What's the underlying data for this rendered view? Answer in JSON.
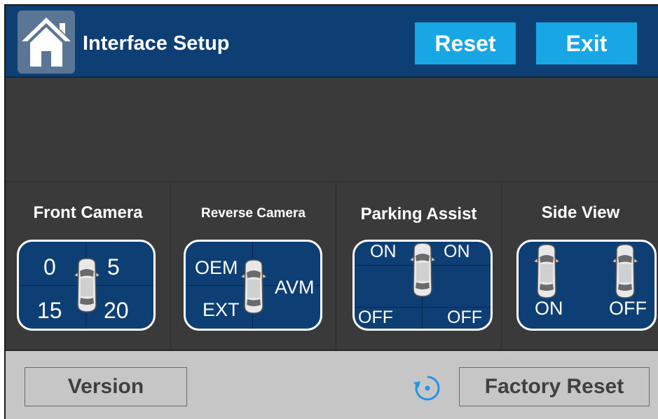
{
  "header": {
    "home_icon": "home-icon",
    "title": "Interface Setup",
    "reset_label": "Reset",
    "exit_label": "Exit"
  },
  "front_camera": {
    "label": "Front Camera",
    "top_left": "0",
    "top_right": "5",
    "bottom_left": "15",
    "bottom_right": "20",
    "icon": "car-top-view-icon"
  },
  "reverse_camera": {
    "label": "Reverse Camera",
    "top_left": "OEM",
    "bottom_left": "EXT",
    "right": "AVM",
    "icon": "car-top-view-icon"
  },
  "parking_assist": {
    "label": "Parking Assist",
    "top_left": "ON",
    "top_right": "ON",
    "bottom_left": "OFF",
    "bottom_right": "OFF",
    "icon": "car-top-view-icon"
  },
  "side_view": {
    "label": "Side View",
    "left": "ON",
    "right": "OFF",
    "icon": "car-side-mirror-icon"
  },
  "footer": {
    "version_label": "Version",
    "factory_reset_label": "Factory Reset",
    "restore_icon": "restore-icon"
  },
  "colors": {
    "header": "#0e3f74",
    "accent": "#18a6e4",
    "panel": "#0e3f74",
    "background": "#3a3a3a",
    "footer": "#c6c6c6"
  }
}
